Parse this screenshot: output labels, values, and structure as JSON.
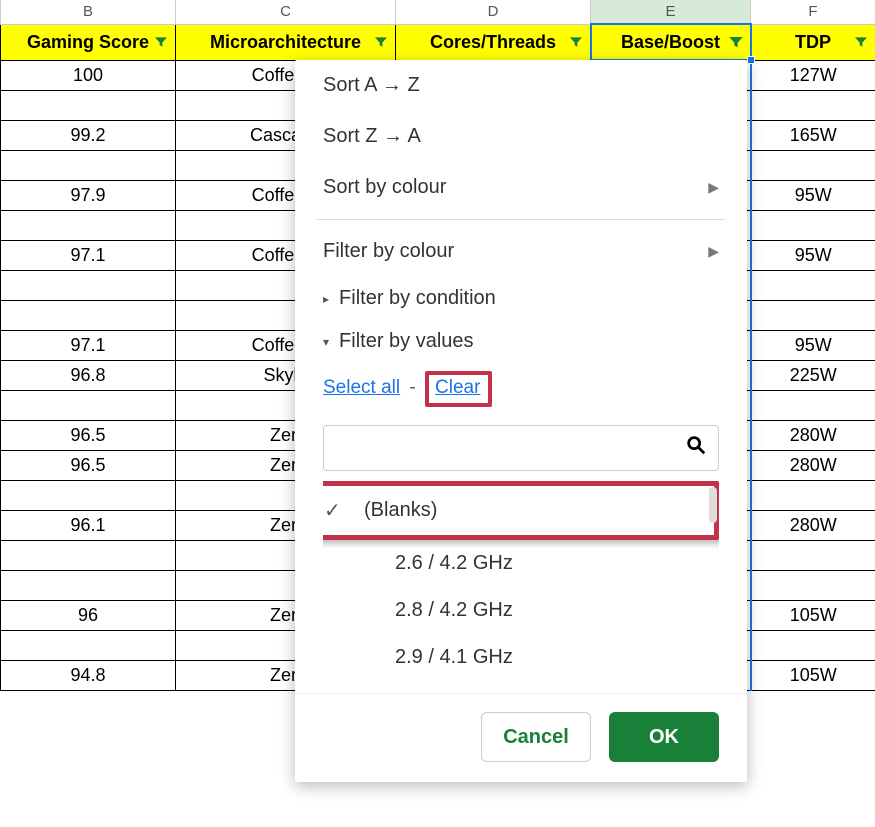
{
  "columns": {
    "letters": [
      "B",
      "C",
      "D",
      "E",
      "F"
    ],
    "headers": [
      "Gaming Score",
      "Microarchitecture",
      "Cores/Threads",
      "Base/Boost",
      "TDP"
    ],
    "active_index": 3
  },
  "rows": [
    {
      "b": "100",
      "c": "Coffee L",
      "f": "127W"
    },
    {
      "blank": true
    },
    {
      "b": "99.2",
      "c": "Cascade",
      "f": "165W"
    },
    {
      "blank": true
    },
    {
      "b": "97.9",
      "c": "Coffee L",
      "f": "95W"
    },
    {
      "blank": true
    },
    {
      "b": "97.1",
      "c": "Coffee L",
      "f": "95W"
    },
    {
      "blank": true
    },
    {
      "blank": true
    },
    {
      "b": "97.1",
      "c": "Coffee L",
      "f": "95W"
    },
    {
      "b": "96.8",
      "c": "Skyla",
      "f": "225W"
    },
    {
      "blank": true
    },
    {
      "b": "96.5",
      "c": "Zen",
      "f": "280W"
    },
    {
      "b": "96.5",
      "c": "Zen",
      "f": "280W"
    },
    {
      "blank": true
    },
    {
      "b": "96.1",
      "c": "Zen",
      "f": "280W"
    },
    {
      "blank": true
    },
    {
      "blank": true
    },
    {
      "b": "96",
      "c": "Zen",
      "f": "105W"
    },
    {
      "blank": true
    },
    {
      "b": "94.8",
      "c": "Zen",
      "f": "105W"
    }
  ],
  "filter_panel": {
    "sort_az": "Sort A → Z",
    "sort_za": "Sort Z → A",
    "sort_colour": "Sort by colour",
    "filter_colour": "Filter by colour",
    "filter_condition": "Filter by condition",
    "filter_values": "Filter by values",
    "select_all": "Select all",
    "clear": "Clear",
    "search_placeholder": "",
    "values": [
      {
        "label": "(Blanks)",
        "checked": true,
        "highlighted": true
      },
      {
        "label": "2.6 / 4.2 GHz",
        "checked": false
      },
      {
        "label": "2.8 / 4.2 GHz",
        "checked": false
      },
      {
        "label": "2.9 / 4.1 GHz",
        "checked": false
      }
    ],
    "cancel": "Cancel",
    "ok": "OK"
  }
}
